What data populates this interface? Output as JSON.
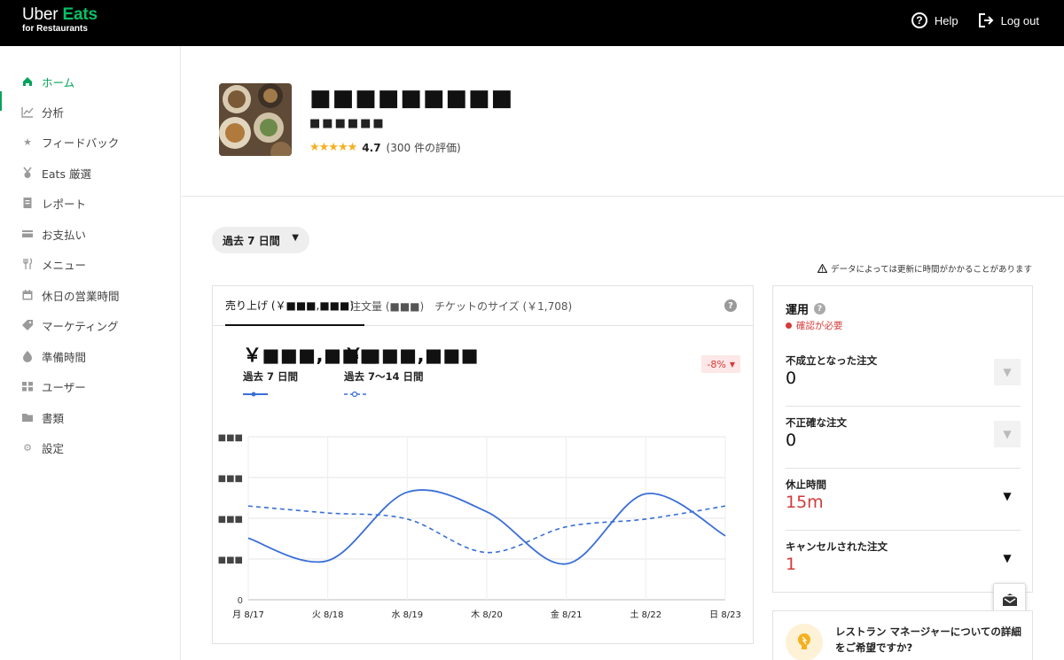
{
  "brand": {
    "line1_a": "Uber",
    "line1_b": "Eats",
    "line2": "for Restaurants"
  },
  "topbar": {
    "help": "Help",
    "logout": "Log out"
  },
  "sidebar": {
    "items": [
      {
        "label": "ホーム",
        "icon": "home-icon"
      },
      {
        "label": "分析",
        "icon": "chart-icon"
      },
      {
        "label": "フィードバック",
        "icon": "star-icon"
      },
      {
        "label": "Eats 厳選",
        "icon": "award-icon"
      },
      {
        "label": "レポート",
        "icon": "report-icon"
      },
      {
        "label": "お支払い",
        "icon": "card-icon"
      },
      {
        "label": "メニュー",
        "icon": "utensils-icon"
      },
      {
        "label": "休日の営業時間",
        "icon": "calendar-icon"
      },
      {
        "label": "マーケティング",
        "icon": "tag-icon"
      },
      {
        "label": "準備時間",
        "icon": "timer-icon"
      },
      {
        "label": "ユーザー",
        "icon": "users-icon"
      },
      {
        "label": "書類",
        "icon": "folder-icon"
      },
      {
        "label": "設定",
        "icon": "gear-icon"
      }
    ]
  },
  "store": {
    "name": "■■■■■■■■■",
    "subtitle": "■■■■■■",
    "rating": "4.7",
    "rating_count": "(300 件の評価)"
  },
  "filters": {
    "period": "過去 7 日間"
  },
  "notice": "データによっては更新に時間がかかることがあります",
  "tabs": [
    {
      "label": "売り上げ (￥■■■,■■■)"
    },
    {
      "label": "注文量 (■■■)"
    },
    {
      "label": "チケットのサイズ (￥1,708)"
    }
  ],
  "summary": {
    "current_value": "￥■■■,■■■",
    "current_label": "過去 7 日間",
    "previous_value": "￥■■■,■■■",
    "previous_label": "過去 7～14 日間",
    "change": "-8%"
  },
  "chart_data": {
    "type": "line",
    "categories": [
      "月 8/17",
      "火 8/18",
      "水 8/19",
      "木 8/20",
      "金 8/21",
      "土 8/22",
      "日 8/23"
    ],
    "yticks": [
      "■■■",
      "■■■",
      "■■■",
      "■■■",
      "0"
    ],
    "ylim": [
      0,
      4
    ],
    "grid": true,
    "series": [
      {
        "values": [
          1.51,
          0.96,
          2.64,
          2.16,
          0.88,
          2.6,
          1.57
        ]
      },
      {
        "values": [
          2.3,
          2.13,
          1.98,
          1.16,
          1.79,
          1.98,
          2.3
        ]
      }
    ],
    "colors": {
      "line": "#3b6fd6"
    }
  },
  "operations": {
    "title": "運用",
    "status": "確認が必要",
    "rows": [
      {
        "label": "不成立となった注文",
        "value": "0",
        "alert": false
      },
      {
        "label": "不正確な注文",
        "value": "0",
        "alert": false
      },
      {
        "label": "休止時間",
        "value": "15m",
        "alert": true
      },
      {
        "label": "キャンセルされた注文",
        "value": "1",
        "alert": true
      }
    ]
  },
  "manager_card": {
    "text": "レストラン マネージャーについての詳細をご希望ですか?"
  }
}
